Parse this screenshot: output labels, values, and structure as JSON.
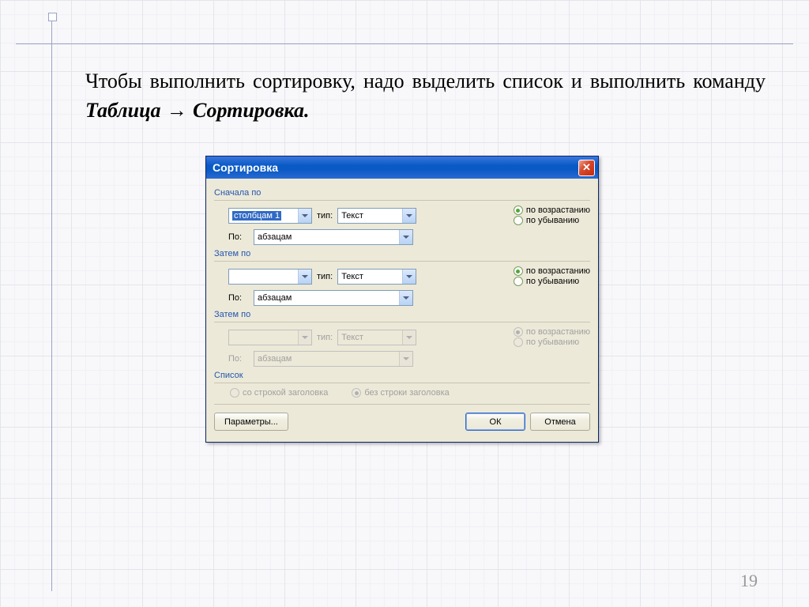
{
  "instruction": {
    "line1_part1": "Чтобы выполнить сортировку, надо выделить список и выполнить команду ",
    "cmd1": "Таблица",
    "arrow": " → ",
    "cmd2": "Сортировка."
  },
  "page_number": "19",
  "dialog": {
    "title": "Сортировка",
    "close_label": "✕",
    "group1": {
      "label": "Сначала по",
      "field_value": "столбцам 1",
      "type_label": "тип:",
      "type_value": "Текст",
      "asc": "по возрастанию",
      "desc": "по убыванию",
      "by_label": "По:",
      "by_value": "абзацам"
    },
    "group2": {
      "label": "Затем по",
      "field_value": "",
      "type_label": "тип:",
      "type_value": "Текст",
      "asc": "по возрастанию",
      "desc": "по убыванию",
      "by_label": "По:",
      "by_value": "абзацам"
    },
    "group3": {
      "label": "Затем по",
      "field_value": "",
      "type_label": "тип:",
      "type_value": "Текст",
      "asc": "по возрастанию",
      "desc": "по убыванию",
      "by_label": "По:",
      "by_value": "абзацам"
    },
    "list_group": {
      "label": "Список",
      "with_header": "со строкой заголовка",
      "without_header": "без строки заголовка"
    },
    "buttons": {
      "params": "Параметры...",
      "ok": "ОК",
      "cancel": "Отмена"
    }
  }
}
